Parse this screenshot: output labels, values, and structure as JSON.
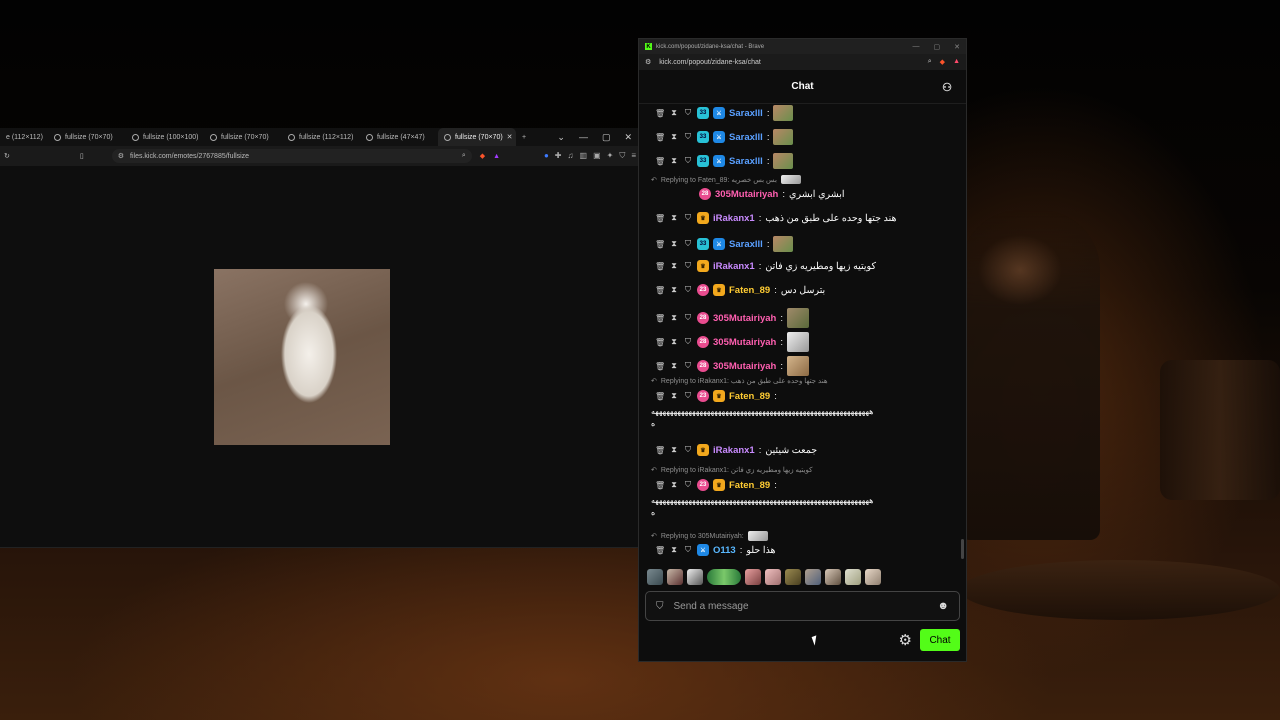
{
  "left_browser": {
    "tabs": [
      {
        "label": "e (112×112)"
      },
      {
        "label": "fullsize (70×70)"
      },
      {
        "label": "fullsize (100×100)"
      },
      {
        "label": "fullsize (70×70)"
      },
      {
        "label": "fullsize (112×112)"
      },
      {
        "label": "fullsize (47×47)"
      },
      {
        "label": "fullsize (70×70)",
        "active": true
      }
    ],
    "new_tab": "+",
    "address": "files.kick.com/emotes/2767885/fullsize"
  },
  "chat_window": {
    "title": "kick.com/popout/zidane-ksa/chat - Brave",
    "url": "kick.com/popout/zidane-ksa/chat",
    "header": "Chat",
    "messages": [
      {
        "user": "Saraxlll",
        "text": ""
      },
      {
        "user": "Saraxlll",
        "text": ""
      },
      {
        "user": "Saraxlll",
        "text": ""
      },
      {
        "reply": "Replying to Faten_89: بس بس خصريه"
      },
      {
        "user": "305Mutairiyah",
        "text": "ابشري ابشري"
      },
      {
        "user": "iRakanx1",
        "text": "هند جتها وحده على طبق من ذهب"
      },
      {
        "user": "Saraxlll",
        "text": ""
      },
      {
        "user": "iRakanx1",
        "text": "كويتيه زيها ومطيريه زي فاتن"
      },
      {
        "user": "Faten_89",
        "text": "بترسل دس"
      },
      {
        "user": "305Mutairiyah",
        "text": ""
      },
      {
        "user": "305Mutairiyah",
        "text": ""
      },
      {
        "user": "305Mutairiyah",
        "text": ""
      },
      {
        "reply": "Replying to iRakanx1: هند جتها وحده على طبق من ذهب"
      },
      {
        "user": "Faten_89",
        "text": ""
      },
      {
        "long": "هههههههههههههههههههههههههههههههههههههههههههههههههههههههههههه",
        "tail": "ه"
      },
      {
        "user": "iRakanx1",
        "text": "جمعت شيئين"
      },
      {
        "reply": "Replying to iRakanx1: كويتيه زيها ومطيريه زي فاتن"
      },
      {
        "user": "Faten_89",
        "text": ""
      },
      {
        "long": "هههههههههههههههههههههههههههههههههههههههههههههههههههههههههههه",
        "tail": "ه"
      },
      {
        "reply": "Replying to 305Mutairiyah:"
      },
      {
        "user": "O113",
        "text": "هذا حلو"
      }
    ],
    "badges": {
      "sub33": "33",
      "sub23": "23",
      "sub28": "28"
    },
    "input_placeholder": "Send a message",
    "chat_button": "Chat"
  },
  "colors": {
    "kick_green": "#53fc18",
    "sarax": "#5aa0ff",
    "mutairiyah": "#ff5fb0",
    "rakan": "#c98bff",
    "faten": "#ffcc33",
    "o113": "#59b8ff"
  }
}
